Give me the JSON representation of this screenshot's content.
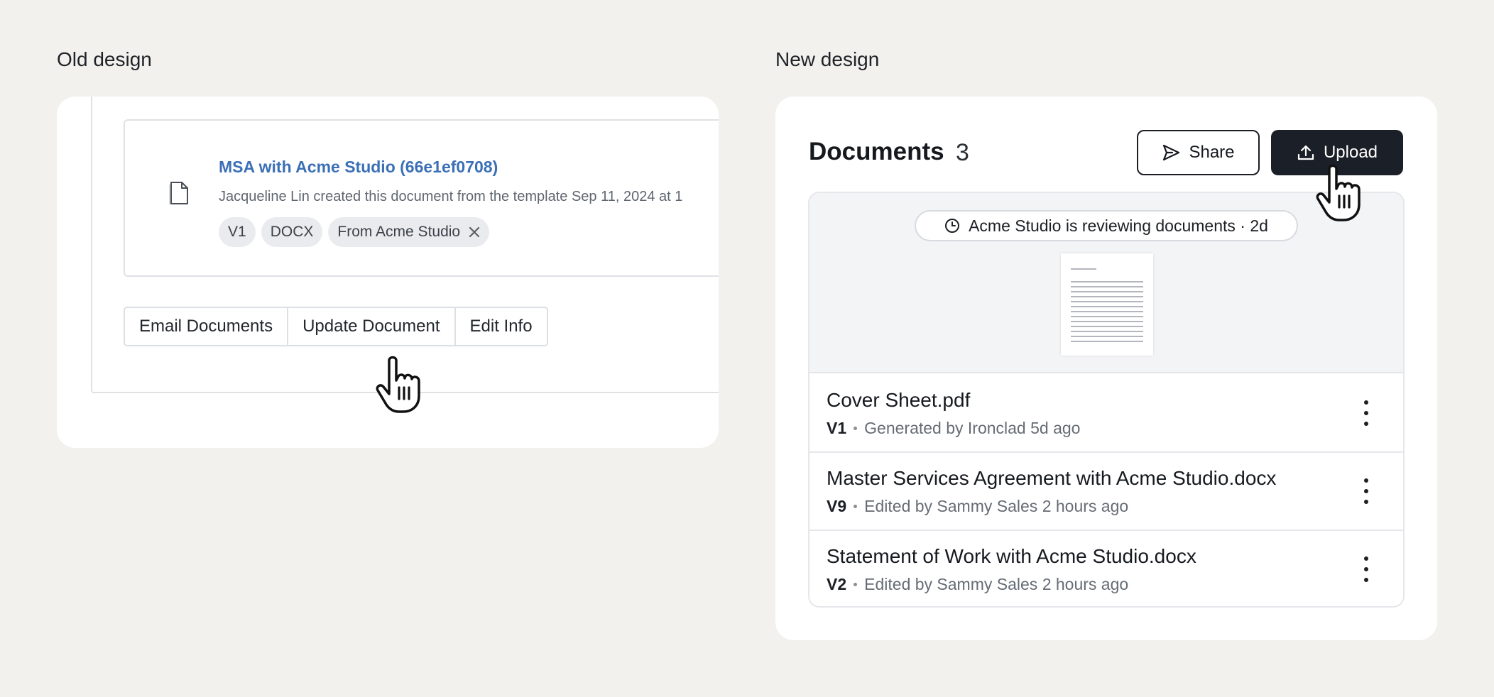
{
  "old_design": {
    "label": "Old design",
    "document": {
      "title": "MSA with Acme Studio (66e1ef0708)",
      "meta": "Jacqueline Lin created this document from the template Sep 11, 2024 at 1",
      "tags": [
        "V1",
        "DOCX",
        "From Acme Studio"
      ]
    },
    "actions": [
      "Email Documents",
      "Update Document",
      "Edit Info"
    ]
  },
  "new_design": {
    "label": "New design",
    "header": {
      "title": "Documents",
      "count": "3"
    },
    "buttons": {
      "share": "Share",
      "upload": "Upload"
    },
    "status": "Acme Studio is reviewing documents · 2d",
    "documents": [
      {
        "name": "Cover Sheet.pdf",
        "version": "V1",
        "detail": "Generated by Ironclad 5d ago"
      },
      {
        "name": "Master Services Agreement with Acme Studio.docx",
        "version": "V9",
        "detail": "Edited by Sammy Sales 2 hours ago"
      },
      {
        "name": "Statement of Work with Acme Studio.docx",
        "version": "V2",
        "detail": "Edited by Sammy Sales 2 hours ago"
      }
    ]
  },
  "colors": {
    "page_bg": "#f2f1ee",
    "link": "#3b6fb6",
    "primary_button": "#1b1f27"
  },
  "icons": [
    "document-icon",
    "close-icon",
    "send-icon",
    "upload-icon",
    "clock-icon",
    "more-vertical-icon",
    "hand-pointer-icon"
  ]
}
